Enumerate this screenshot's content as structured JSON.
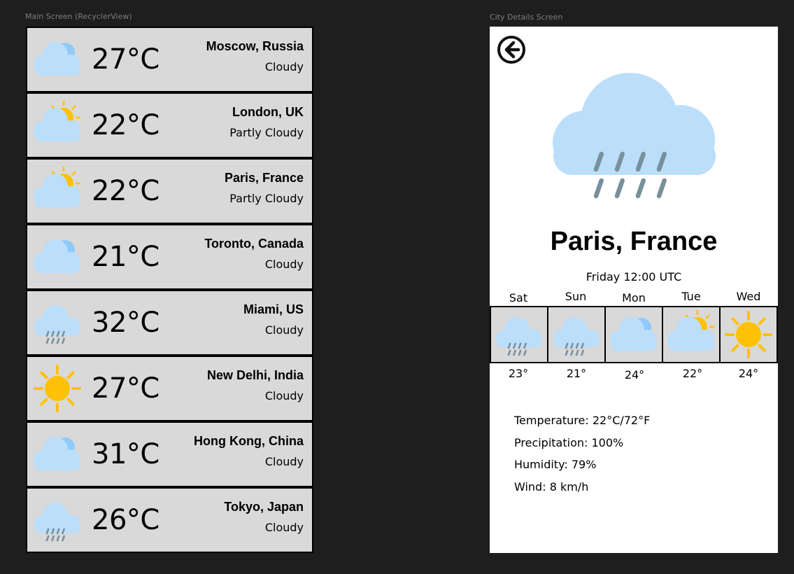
{
  "frames": {
    "main_label": "Main Screen (RecyclerView)",
    "detail_label": "City Details Screen"
  },
  "colors": {
    "cloud": "#bbdefb",
    "cloud_shade": "#90caf9",
    "sun": "#ffc107",
    "rain": "#78909c",
    "row_bg": "#d9d9d9",
    "canvas_bg": "#1e1e1e"
  },
  "cities": [
    {
      "temp": "27°C",
      "city": "Moscow, Russia",
      "condition": "Cloudy",
      "icon": "cloudy-icon"
    },
    {
      "temp": "22°C",
      "city": "London, UK",
      "condition": "Partly Cloudy",
      "icon": "partly-cloudy-icon"
    },
    {
      "temp": "22°C",
      "city": "Paris, France",
      "condition": "Partly Cloudy",
      "icon": "partly-cloudy-icon"
    },
    {
      "temp": "21°C",
      "city": "Toronto, Canada",
      "condition": "Cloudy",
      "icon": "cloudy-icon"
    },
    {
      "temp": "32°C",
      "city": "Miami, US",
      "condition": "Cloudy",
      "icon": "rain-cloud-icon"
    },
    {
      "temp": "27°C",
      "city": "New Delhi, India",
      "condition": "Cloudy",
      "icon": "sun-icon"
    },
    {
      "temp": "31°C",
      "city": "Hong Kong, China",
      "condition": "Cloudy",
      "icon": "cloudy-icon"
    },
    {
      "temp": "26°C",
      "city": "Tokyo, Japan",
      "condition": "Cloudy",
      "icon": "rain-cloud-icon"
    }
  ],
  "detail": {
    "back_icon": "back-arrow-icon",
    "hero_icon": "rain-cloud-icon",
    "city": "Paris, France",
    "time": "Friday 12:00 UTC",
    "forecast": [
      {
        "day": "Sat",
        "temp": "23°",
        "icon": "rain-cloud-icon"
      },
      {
        "day": "Sun",
        "temp": "21°",
        "icon": "rain-cloud-icon"
      },
      {
        "day": "Mon",
        "temp": "24°",
        "icon": "cloudy-icon"
      },
      {
        "day": "Tue",
        "temp": "22°",
        "icon": "partly-cloudy-icon"
      },
      {
        "day": "Wed",
        "temp": "24°",
        "icon": "sun-icon"
      }
    ],
    "stats": {
      "temperature": "Temperature: 22°C/72°F",
      "precipitation": "Precipitation: 100%",
      "humidity": "Humidity: 79%",
      "wind": "Wind: 8 km/h"
    }
  }
}
